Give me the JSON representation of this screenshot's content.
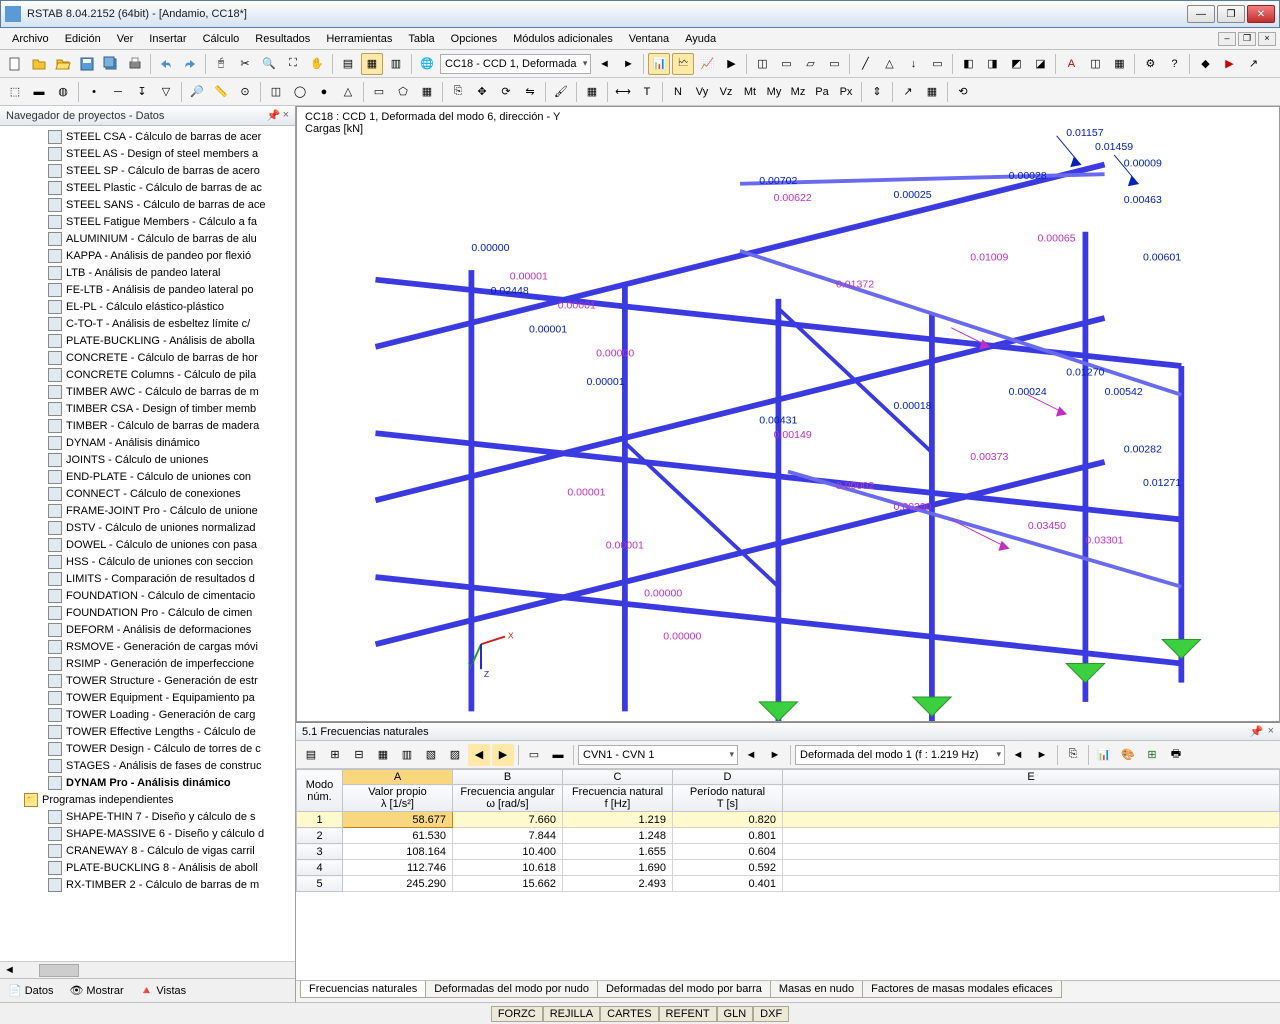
{
  "window": {
    "title": "RSTAB 8.04.2152 (64bit) - [Andamio, CC18*]"
  },
  "menu": [
    "Archivo",
    "Edición",
    "Ver",
    "Insertar",
    "Cálculo",
    "Resultados",
    "Herramientas",
    "Tabla",
    "Opciones",
    "Módulos adicionales",
    "Ventana",
    "Ayuda"
  ],
  "toolbar_combo_main": "CC18 - CCD 1, Deformada",
  "sidebar": {
    "title": "Navegador de proyectos - Datos",
    "items": [
      {
        "t": "STEEL CSA - Cálculo de barras de acer"
      },
      {
        "t": "STEEL AS - Design of steel members a"
      },
      {
        "t": "STEEL SP - Cálculo de barras de acero"
      },
      {
        "t": "STEEL Plastic - Cálculo de barras de ac"
      },
      {
        "t": "STEEL SANS - Cálculo de barras de ace"
      },
      {
        "t": "STEEL Fatigue Members - Cálculo a fa"
      },
      {
        "t": "ALUMINIUM - Cálculo de barras de alu"
      },
      {
        "t": "KAPPA - Análisis de pandeo por flexió"
      },
      {
        "t": "LTB - Análisis de pandeo lateral"
      },
      {
        "t": "FE-LTB - Análisis de pandeo lateral po"
      },
      {
        "t": "EL-PL - Cálculo elástico-plástico"
      },
      {
        "t": "C-TO-T - Análisis de esbeltez límite c/"
      },
      {
        "t": "PLATE-BUCKLING - Análisis de abolla"
      },
      {
        "t": "CONCRETE - Cálculo de barras de hor"
      },
      {
        "t": "CONCRETE Columns - Cálculo de pila"
      },
      {
        "t": "TIMBER AWC - Cálculo de barras de m"
      },
      {
        "t": "TIMBER CSA - Design of timber memb"
      },
      {
        "t": "TIMBER - Cálculo de barras de madera"
      },
      {
        "t": "DYNAM - Análisis dinámico"
      },
      {
        "t": "JOINTS - Cálculo de uniones"
      },
      {
        "t": "END-PLATE - Cálculo de uniones con"
      },
      {
        "t": "CONNECT - Cálculo de conexiones"
      },
      {
        "t": "FRAME-JOINT Pro - Cálculo de unione"
      },
      {
        "t": "DSTV - Cálculo de uniones normalizad"
      },
      {
        "t": "DOWEL - Cálculo de uniones con pasa"
      },
      {
        "t": "HSS - Cálculo de uniones con seccion"
      },
      {
        "t": "LIMITS - Comparación de resultados d"
      },
      {
        "t": "FOUNDATION - Cálculo de cimentacio"
      },
      {
        "t": "FOUNDATION Pro - Cálculo de cimen"
      },
      {
        "t": "DEFORM - Análisis de deformaciones"
      },
      {
        "t": "RSMOVE - Generación de cargas móvi"
      },
      {
        "t": "RSIMP - Generación de imperfeccione"
      },
      {
        "t": "TOWER Structure - Generación de estr"
      },
      {
        "t": "TOWER Equipment - Equipamiento pa"
      },
      {
        "t": "TOWER Loading - Generación de carg"
      },
      {
        "t": "TOWER Effective Lengths - Cálculo de"
      },
      {
        "t": "TOWER Design - Cálculo de torres de c"
      },
      {
        "t": "STAGES - Análisis de fases de construc"
      },
      {
        "t": "DYNAM Pro - Análisis dinámico",
        "bold": true
      },
      {
        "t": "Programas independientes",
        "group": true
      },
      {
        "t": "SHAPE-THIN 7 - Diseño y cálculo de s"
      },
      {
        "t": "SHAPE-MASSIVE 6 - Diseño y cálculo d"
      },
      {
        "t": "CRANEWAY 8 - Cálculo de vigas carril"
      },
      {
        "t": "PLATE-BUCKLING 8 - Análisis de aboll"
      },
      {
        "t": "RX-TIMBER 2 - Cálculo de barras de m"
      }
    ],
    "tabs": [
      "Datos",
      "Mostrar",
      "Vistas"
    ]
  },
  "viewport": {
    "header_line1": "CC18 : CCD 1, Deformada del modo 6, dirección - Y",
    "header_line2": "Cargas [kN]"
  },
  "table": {
    "title": "5.1 Frecuencias naturales",
    "combo1": "CVN1 - CVN 1",
    "combo2": "Deformada del modo 1 (f : 1.219 Hz)",
    "col_letters": [
      "A",
      "B",
      "C",
      "D",
      "E"
    ],
    "headers": {
      "row": "Modo\nnúm.",
      "A": "Valor propio\nλ [1/s²]",
      "B": "Frecuencia angular\nω [rad/s]",
      "C": "Frecuencia natural\nf [Hz]",
      "D": "Período natural\nT [s]"
    },
    "rows": [
      {
        "n": "1",
        "A": "58.677",
        "B": "7.660",
        "C": "1.219",
        "D": "0.820",
        "sel": true
      },
      {
        "n": "2",
        "A": "61.530",
        "B": "7.844",
        "C": "1.248",
        "D": "0.801"
      },
      {
        "n": "3",
        "A": "108.164",
        "B": "10.400",
        "C": "1.655",
        "D": "0.604"
      },
      {
        "n": "4",
        "A": "112.746",
        "B": "10.618",
        "C": "1.690",
        "D": "0.592"
      },
      {
        "n": "5",
        "A": "245.290",
        "B": "15.662",
        "C": "2.493",
        "D": "0.401"
      }
    ],
    "tabs": [
      "Frecuencias naturales",
      "Deformadas del modo por nudo",
      "Deformadas del modo por barra",
      "Masas en nudo",
      "Factores de masas modales eficaces"
    ]
  },
  "status": [
    "FORZC",
    "REJILLA",
    "CARTES",
    "REFENT",
    "GLN",
    "DXF"
  ]
}
